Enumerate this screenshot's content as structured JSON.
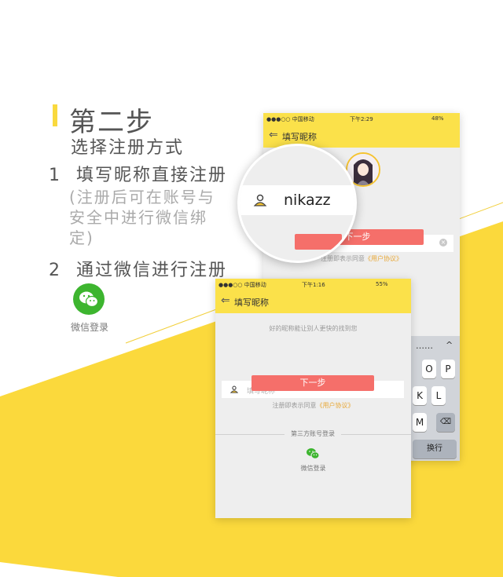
{
  "intro": {
    "title": "第二步",
    "subtitle": "选择注册方式",
    "option1_num": "1",
    "option1_text": "填写昵称直接注册",
    "option1_note": "(注册后可在账号与安全中进行微信绑定)",
    "option2_num": "2",
    "option2_text": "通过微信进行注册",
    "wechat_label": "微信登录"
  },
  "phone_back": {
    "status_carrier": "●●●○○ 中国移动",
    "status_time": "下午2:29",
    "status_battery": "48%",
    "nav_title": "填写昵称",
    "next_button": "下一步",
    "agree_text": "注册即表示同意",
    "agree_link": "《用户协议》",
    "keyboard": {
      "dots": "……",
      "keys_row1": [
        "O",
        "P"
      ],
      "keys_row2": [
        "K",
        "L"
      ],
      "keys_row3": [
        "M"
      ],
      "return_key": "换行"
    }
  },
  "magnifier": {
    "nickname_value": "nikazz"
  },
  "phone_front": {
    "status_carrier": "●●●○○ 中国移动",
    "status_time": "下午1:16",
    "status_battery": "55%",
    "nav_title": "填写昵称",
    "hint": "好的昵称能让别人更快的找到您",
    "nickname_placeholder": "填写昵称",
    "next_button": "下一步",
    "agree_text": "注册即表示同意",
    "agree_link": "《用户协议》",
    "third_party_label": "第三方账号登录",
    "wechat_label": "微信登录"
  },
  "colors": {
    "accent_yellow": "#fbe14a",
    "button_red": "#f56f6a",
    "wechat_green": "#3db52f"
  }
}
